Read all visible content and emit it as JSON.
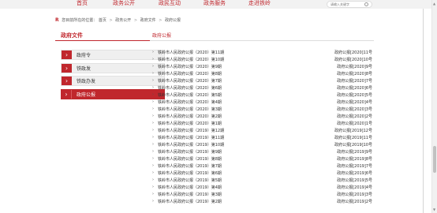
{
  "nav": {
    "items": [
      "首页",
      "政务公开",
      "政民互动",
      "政务服务",
      "走进铁岭"
    ],
    "search_placeholder": "请输入关键字"
  },
  "breadcrumb": {
    "home_icon": "R",
    "prefix": "您目前所在的位置：",
    "crumbs": [
      "首页",
      "政务公开",
      "政府文件",
      "政府公报"
    ]
  },
  "sidebar": {
    "title": "政府文件",
    "items": [
      {
        "label": "政府令",
        "active": false
      },
      {
        "label": "铁政发",
        "active": false
      },
      {
        "label": "铁政办发",
        "active": false
      },
      {
        "label": "政府公报",
        "active": true
      }
    ]
  },
  "main": {
    "title": "政府公报",
    "list": [
      {
        "title": "铁岭市人民政府公报（2020）第11期",
        "issue": "政府公报[2020]11号"
      },
      {
        "title": "铁岭市人民政府公报（2020）第10期",
        "issue": "政府公报[2020]10号"
      },
      {
        "title": "铁岭市人民政府公报（2020）第9期",
        "issue": "政府公报[2020]9号"
      },
      {
        "title": "铁岭市人民政府公报（2020）第8期",
        "issue": "政府公报[2020]8号"
      },
      {
        "title": "铁岭市人民政府公报（2020）第7期",
        "issue": "政府公报[2020]7号"
      },
      {
        "title": "铁岭市人民政府公报（2020）第6期",
        "issue": "政府公报[2020]6号"
      },
      {
        "title": "铁岭市人民政府公报（2020）第5期",
        "issue": "政府公报[2020]5号"
      },
      {
        "title": "铁岭市人民政府公报（2020）第4期",
        "issue": "政府公报[2020]4号"
      },
      {
        "title": "铁岭市人民政府公报（2020）第3期",
        "issue": "政府公报[2020]3号"
      },
      {
        "title": "铁岭市人民政府公报（2020）第2期",
        "issue": "政府公报[2020]2号"
      },
      {
        "title": "铁岭市人民政府公报（2020）第1期",
        "issue": "政府公报[2020]1号"
      },
      {
        "title": "铁岭市人民政府公报（2019）第12期",
        "issue": "政府公报[2019]12号"
      },
      {
        "title": "铁岭市人民政府公报（2019）第11期",
        "issue": "政府公报[2019]11号"
      },
      {
        "title": "铁岭市人民政府公报（2019）第10期",
        "issue": "政府公报[2019]10号"
      },
      {
        "title": "铁岭市人民政府公报（2019）第9期",
        "issue": "政府公报[2019]9号"
      },
      {
        "title": "铁岭市人民政府公报（2019）第8期",
        "issue": "政府公报[2019]8号"
      },
      {
        "title": "铁岭市人民政府公报（2019）第7期",
        "issue": "政府公报[2019]7号"
      },
      {
        "title": "铁岭市人民政府公报（2019）第6期",
        "issue": "政府公报[2019]6号"
      },
      {
        "title": "铁岭市人民政府公报（2019）第5期",
        "issue": "政府公报[2019]5号"
      },
      {
        "title": "铁岭市人民政府公报（2019）第4期",
        "issue": "政府公报[2019]4号"
      },
      {
        "title": "铁岭市人民政府公报（2019）第3期",
        "issue": "政府公报[2019]3号"
      },
      {
        "title": "铁岭市人民政府公报（2019）第2期",
        "issue": "政府公报[2019]2号"
      }
    ]
  },
  "colors": {
    "accent": "#c0272d"
  },
  "icons": {
    "home": "home-icon",
    "search": "search-icon",
    "arrow": "chevron-right-icon"
  }
}
